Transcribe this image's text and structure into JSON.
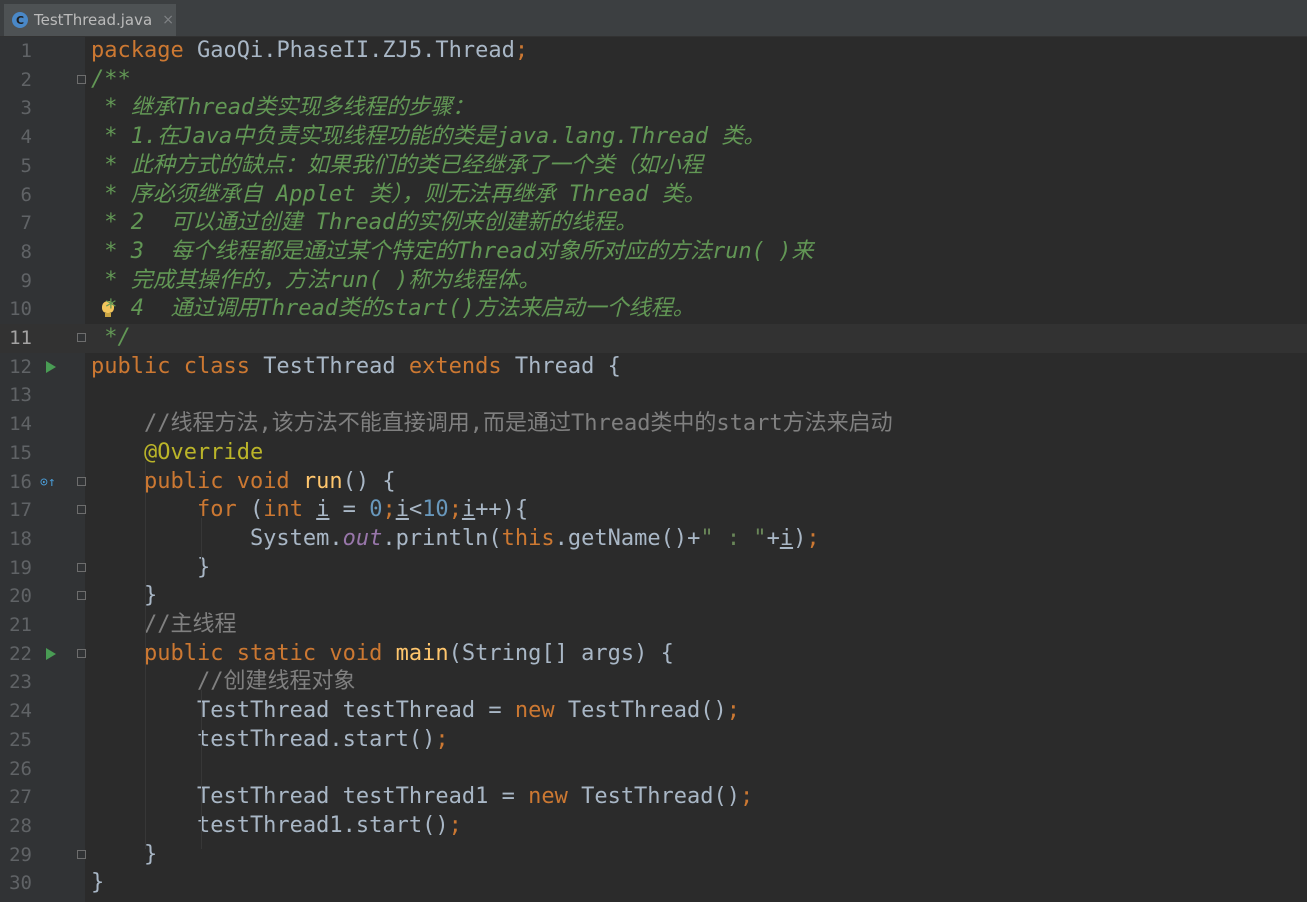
{
  "tab": {
    "icon_letter": "C",
    "filename": "TestThread.java",
    "close_glyph": "×"
  },
  "editor": {
    "current_line": 11,
    "lines": [
      {
        "n": "1",
        "tokens": [
          {
            "c": "kw",
            "t": "package "
          },
          {
            "c": "",
            "t": "GaoQi.PhaseII.ZJ5.Thread"
          },
          {
            "c": "kw",
            "t": ";"
          }
        ]
      },
      {
        "n": "2",
        "tokens": [
          {
            "c": "cm",
            "t": "/**"
          }
        ]
      },
      {
        "n": "3",
        "tokens": [
          {
            "c": "cm",
            "t": " * 继承Thread类实现多线程的步骤："
          }
        ]
      },
      {
        "n": "4",
        "tokens": [
          {
            "c": "cm",
            "t": " * 1.在Java中负责实现线程功能的类是java.lang.Thread 类。"
          }
        ]
      },
      {
        "n": "5",
        "tokens": [
          {
            "c": "cm",
            "t": " * 此种方式的缺点：如果我们的类已经继承了一个类（如小程"
          }
        ]
      },
      {
        "n": "6",
        "tokens": [
          {
            "c": "cm",
            "t": " * 序必须继承自 Applet 类），则无法再继承 Thread 类。"
          }
        ]
      },
      {
        "n": "7",
        "tokens": [
          {
            "c": "cm",
            "t": " * 2  可以通过创建 Thread的实例来创建新的线程。"
          }
        ]
      },
      {
        "n": "8",
        "tokens": [
          {
            "c": "cm",
            "t": " * 3  每个线程都是通过某个特定的Thread对象所对应的方法run( )来"
          }
        ]
      },
      {
        "n": "9",
        "tokens": [
          {
            "c": "cm",
            "t": " * 完成其操作的，方法run( )称为线程体。"
          }
        ]
      },
      {
        "n": "10",
        "tokens": [
          {
            "c": "cm",
            "t": " * 4  通过调用Thread类的start()方法来启动一个线程。"
          }
        ]
      },
      {
        "n": "11",
        "tokens": [
          {
            "c": "cm",
            "t": " */"
          }
        ]
      },
      {
        "n": "12",
        "tokens": [
          {
            "c": "kw",
            "t": "public class "
          },
          {
            "c": "",
            "t": "TestThread "
          },
          {
            "c": "kw",
            "t": "extends "
          },
          {
            "c": "",
            "t": "Thread {"
          }
        ]
      },
      {
        "n": "13",
        "tokens": []
      },
      {
        "n": "14",
        "tokens": [
          {
            "c": "",
            "t": "    "
          },
          {
            "c": "lc",
            "t": "//线程方法,该方法不能直接调用,而是通过Thread类中的start方法来启动"
          }
        ]
      },
      {
        "n": "15",
        "tokens": [
          {
            "c": "",
            "t": "    "
          },
          {
            "c": "an",
            "t": "@Override"
          }
        ]
      },
      {
        "n": "16",
        "tokens": [
          {
            "c": "",
            "t": "    "
          },
          {
            "c": "kw",
            "t": "public void "
          },
          {
            "c": "fn",
            "t": "run"
          },
          {
            "c": "",
            "t": "() {"
          }
        ]
      },
      {
        "n": "17",
        "tokens": [
          {
            "c": "",
            "t": "        "
          },
          {
            "c": "kw",
            "t": "for "
          },
          {
            "c": "",
            "t": "("
          },
          {
            "c": "kw",
            "t": "int "
          },
          {
            "c": "vr",
            "t": "i"
          },
          {
            "c": "",
            "t": " = "
          },
          {
            "c": "nm",
            "t": "0"
          },
          {
            "c": "kw",
            "t": ";"
          },
          {
            "c": "vr",
            "t": "i"
          },
          {
            "c": "",
            "t": "<"
          },
          {
            "c": "nm",
            "t": "10"
          },
          {
            "c": "kw",
            "t": ";"
          },
          {
            "c": "vr",
            "t": "i"
          },
          {
            "c": "",
            "t": "++){"
          }
        ]
      },
      {
        "n": "18",
        "tokens": [
          {
            "c": "",
            "t": "            System."
          },
          {
            "c": "fl",
            "t": "out"
          },
          {
            "c": "",
            "t": ".println("
          },
          {
            "c": "kw",
            "t": "this"
          },
          {
            "c": "",
            "t": ".getName()+"
          },
          {
            "c": "st",
            "t": "\" : \""
          },
          {
            "c": "",
            "t": "+"
          },
          {
            "c": "vr",
            "t": "i"
          },
          {
            "c": "",
            "t": ")"
          },
          {
            "c": "kw",
            "t": ";"
          }
        ]
      },
      {
        "n": "19",
        "tokens": [
          {
            "c": "",
            "t": "        }"
          }
        ]
      },
      {
        "n": "20",
        "tokens": [
          {
            "c": "",
            "t": "    }"
          }
        ]
      },
      {
        "n": "21",
        "tokens": [
          {
            "c": "",
            "t": "    "
          },
          {
            "c": "lc",
            "t": "//主线程"
          }
        ]
      },
      {
        "n": "22",
        "tokens": [
          {
            "c": "",
            "t": "    "
          },
          {
            "c": "kw",
            "t": "public static void "
          },
          {
            "c": "fn",
            "t": "main"
          },
          {
            "c": "",
            "t": "(String[] args) {"
          }
        ]
      },
      {
        "n": "23",
        "tokens": [
          {
            "c": "",
            "t": "        "
          },
          {
            "c": "lc",
            "t": "//创建线程对象"
          }
        ]
      },
      {
        "n": "24",
        "tokens": [
          {
            "c": "",
            "t": "        TestThread testThread = "
          },
          {
            "c": "kw",
            "t": "new "
          },
          {
            "c": "",
            "t": "TestThread()"
          },
          {
            "c": "kw",
            "t": ";"
          }
        ]
      },
      {
        "n": "25",
        "tokens": [
          {
            "c": "",
            "t": "        testThread.start()"
          },
          {
            "c": "kw",
            "t": ";"
          }
        ]
      },
      {
        "n": "26",
        "tokens": []
      },
      {
        "n": "27",
        "tokens": [
          {
            "c": "",
            "t": "        TestThread testThread1 = "
          },
          {
            "c": "kw",
            "t": "new "
          },
          {
            "c": "",
            "t": "TestThread()"
          },
          {
            "c": "kw",
            "t": ";"
          }
        ]
      },
      {
        "n": "28",
        "tokens": [
          {
            "c": "",
            "t": "        testThread1.start()"
          },
          {
            "c": "kw",
            "t": ";"
          }
        ]
      },
      {
        "n": "29",
        "tokens": [
          {
            "c": "",
            "t": "    }"
          }
        ]
      },
      {
        "n": "30",
        "tokens": [
          {
            "c": "",
            "t": "}"
          }
        ]
      }
    ],
    "gutter_icons": {
      "10": "bulb-icon",
      "12": "run-icon",
      "16": "override-icon",
      "22": "run-icon"
    },
    "fold_marks": [
      "2",
      "11",
      "16",
      "17",
      "19",
      "20",
      "22",
      "29"
    ]
  }
}
